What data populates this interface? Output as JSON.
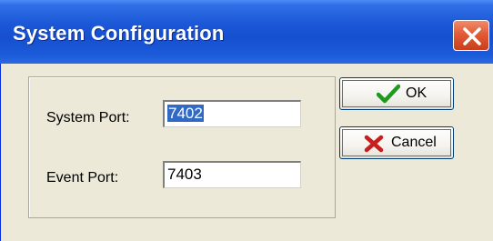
{
  "window": {
    "title": "System Configuration"
  },
  "form": {
    "system_port_label": "System Port:",
    "system_port_value": "7402",
    "event_port_label": "Event Port:",
    "event_port_value": "7403"
  },
  "buttons": {
    "ok_label": "OK",
    "cancel_label": "Cancel"
  },
  "icons": {
    "ok": "checkmark-icon",
    "cancel": "x-icon",
    "close": "close-icon"
  },
  "colors": {
    "titlebar": "#1a56d6",
    "close_button": "#e25a36",
    "ok_check": "#1f9a1f",
    "cancel_x": "#c81e1e",
    "selection": "#316ac5"
  }
}
